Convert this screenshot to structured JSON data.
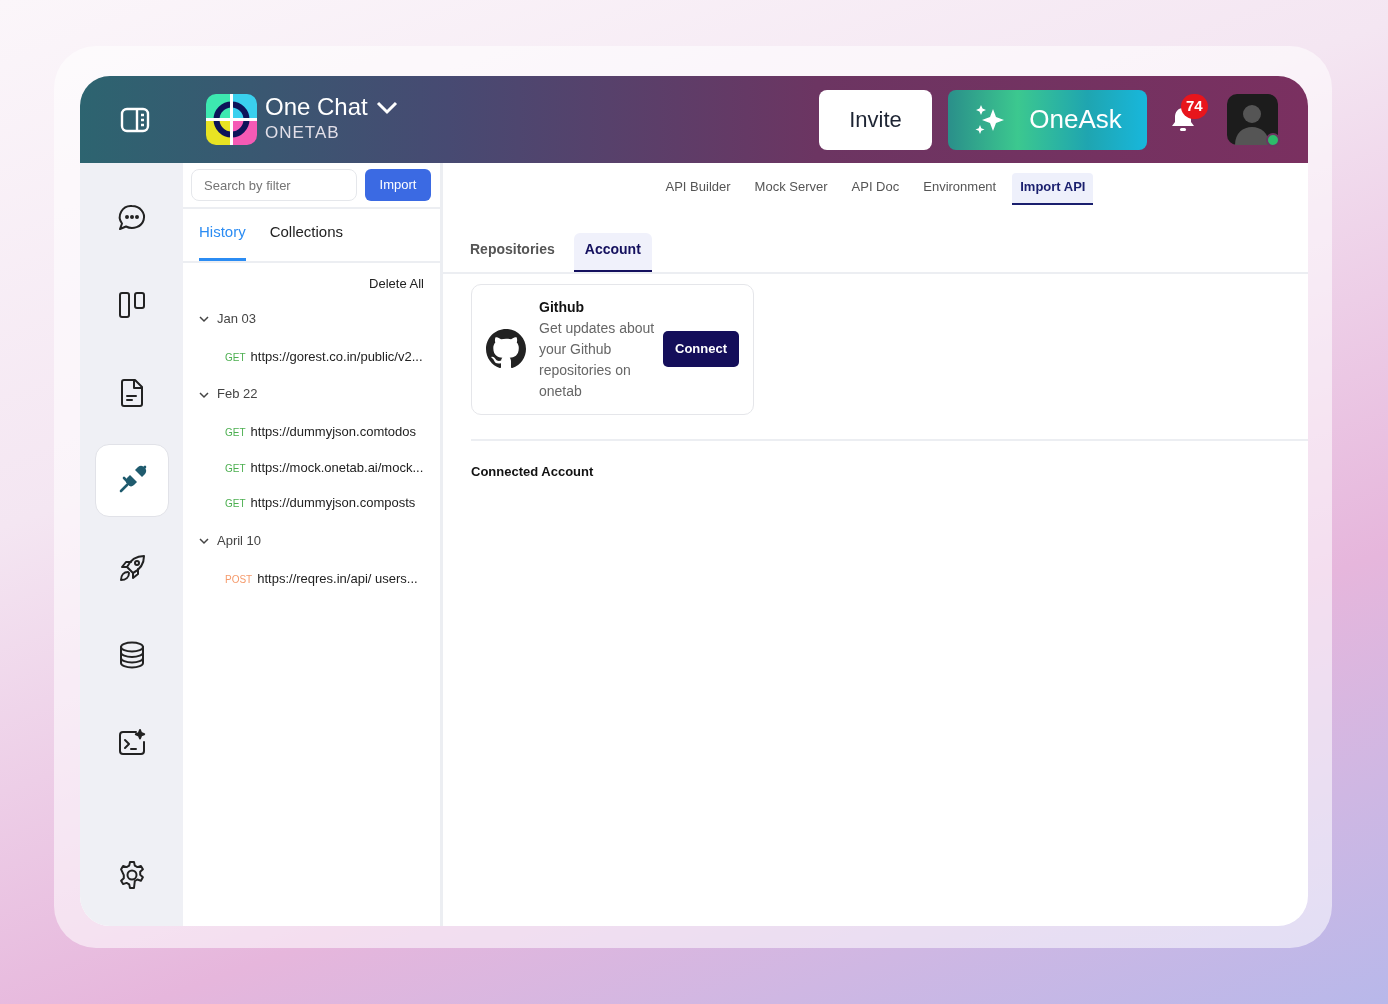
{
  "header": {
    "app_name": "One Chat",
    "workspace": "ONETAB",
    "invite_button": "Invite",
    "oneask_button": "OneAsk",
    "notification_count": "74",
    "user_online": true
  },
  "rail": [
    {
      "kind": "chat",
      "selected": false
    },
    {
      "kind": "columns",
      "selected": false
    },
    {
      "kind": "document",
      "selected": false
    },
    {
      "kind": "plug",
      "selected": true
    },
    {
      "kind": "rocket",
      "selected": false
    },
    {
      "kind": "database",
      "selected": false
    },
    {
      "kind": "terminal",
      "selected": false
    },
    {
      "kind": "settings",
      "selected": false
    }
  ],
  "sidebar": {
    "search": {
      "placeholder": "Search by filter"
    },
    "import_button": "Import",
    "tabs": [
      {
        "label": "History",
        "selected": true
      },
      {
        "label": "Collections",
        "selected": false
      }
    ],
    "delete_all": "Delete All",
    "groups": [
      {
        "date": "Jan 03",
        "expanded": true,
        "requests": [
          {
            "method": "GET",
            "color": "#4caf50",
            "url": "https://gorest.co.in/public/v2..."
          }
        ]
      },
      {
        "date": "Feb 22",
        "expanded": true,
        "requests": [
          {
            "method": "GET",
            "color": "#4caf50",
            "url": "https://dummyjson.comtodos"
          },
          {
            "method": "GET",
            "color": "#4caf50",
            "url": "https://mock.onetab.ai/mock..."
          },
          {
            "method": "GET",
            "color": "#4caf50",
            "url": "https://dummyjson.composts"
          }
        ]
      },
      {
        "date": "April 10",
        "expanded": true,
        "requests": [
          {
            "method": "POST",
            "color": "#f59a6b",
            "url": "https://reqres.in/api/ users..."
          }
        ]
      }
    ]
  },
  "main": {
    "tabs": [
      {
        "label": "API Builder",
        "selected": false
      },
      {
        "label": "Mock Server",
        "selected": false
      },
      {
        "label": "API Doc",
        "selected": false
      },
      {
        "label": "Environment",
        "selected": false
      },
      {
        "label": "Import API",
        "selected": true
      }
    ],
    "sub_tabs": [
      {
        "label": "Repositories",
        "selected": false
      },
      {
        "label": "Account",
        "selected": true
      }
    ],
    "integration": {
      "title": "Github",
      "description": "Get updates about your Github repositories on onetab",
      "button": "Connect"
    },
    "connected_heading": "Connected Account"
  }
}
